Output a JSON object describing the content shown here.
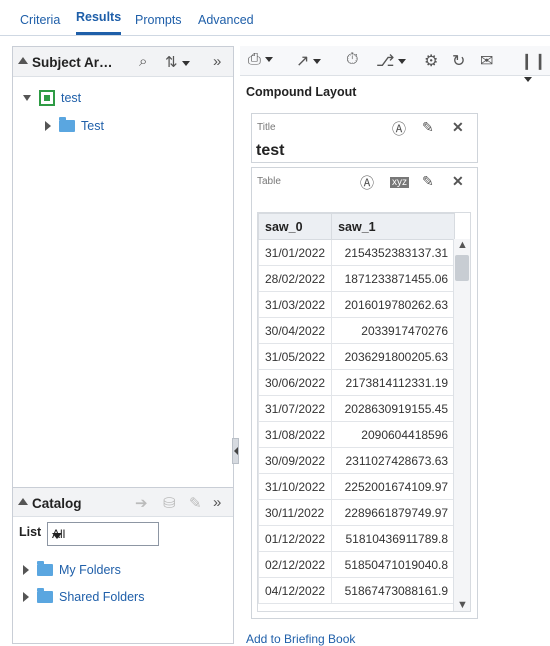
{
  "tabs": [
    {
      "label": "Criteria"
    },
    {
      "label": "Results"
    },
    {
      "label": "Prompts"
    },
    {
      "label": "Advanced"
    }
  ],
  "subject_area": {
    "title": "Subject Ar…",
    "tree": [
      {
        "label": "test"
      },
      {
        "label": "Test"
      }
    ]
  },
  "catalog": {
    "title": "Catalog",
    "list_label": "List",
    "list_value": "All",
    "folders": [
      {
        "label": "My Folders"
      },
      {
        "label": "Shared Folders"
      }
    ]
  },
  "layout": {
    "title": "Compound Layout",
    "title_view": {
      "label": "Title",
      "text": "test"
    },
    "table_view": {
      "label": "Table",
      "columns": [
        "saw_0",
        "saw_1"
      ],
      "rows": [
        [
          "31/01/2022",
          "2154352383137.31"
        ],
        [
          "28/02/2022",
          "1871233871455.06"
        ],
        [
          "31/03/2022",
          "2016019780262.63"
        ],
        [
          "30/04/2022",
          "2033917470276"
        ],
        [
          "31/05/2022",
          "2036291800205.63"
        ],
        [
          "30/06/2022",
          "2173814112331.19"
        ],
        [
          "31/07/2022",
          "2028630919155.45"
        ],
        [
          "31/08/2022",
          "2090604418596"
        ],
        [
          "30/09/2022",
          "2311027428673.63"
        ],
        [
          "31/10/2022",
          "2252001674109.97"
        ],
        [
          "30/11/2022",
          "2289661879749.97"
        ],
        [
          "01/12/2022",
          "51810436911789.8"
        ],
        [
          "02/12/2022",
          "51850471019040.8"
        ],
        [
          "04/12/2022",
          "51867473088161.9"
        ]
      ]
    }
  },
  "briefing_link": "Add to Briefing Book",
  "colors": {
    "accent": "#1f5fa9",
    "tree_icon": "#2e9b44",
    "folder": "#5aa6e0"
  }
}
